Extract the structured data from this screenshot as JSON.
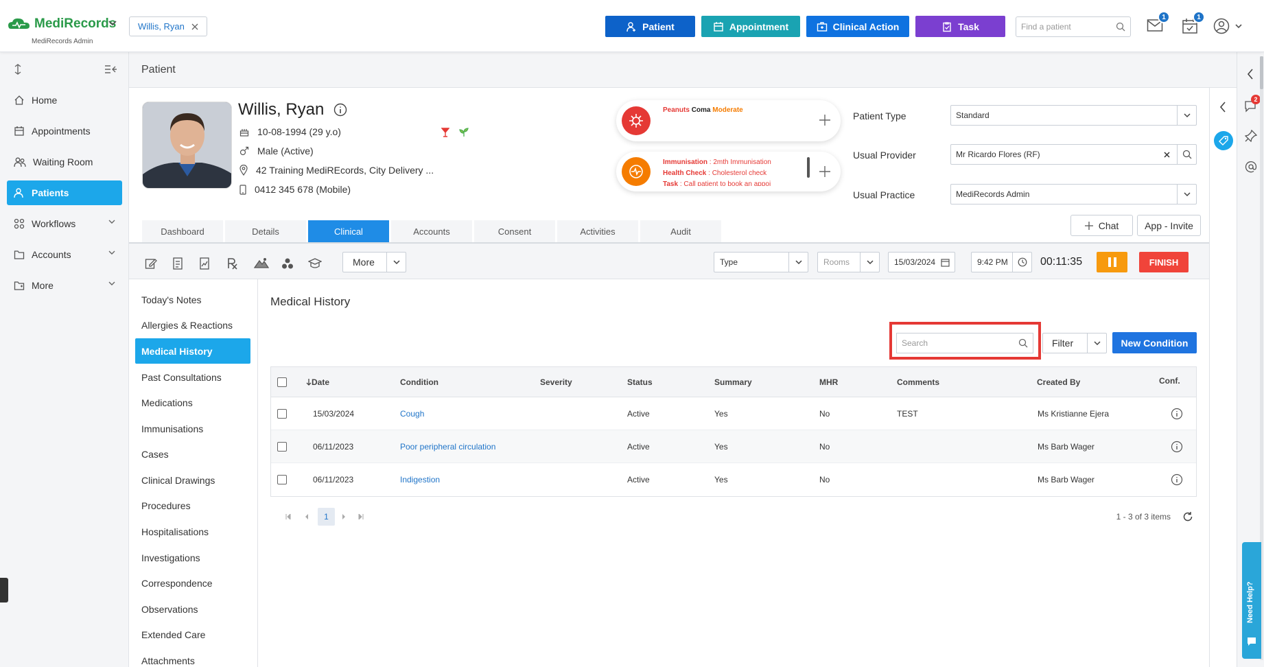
{
  "header": {
    "brand_name": "MediRecords",
    "brand_sub": "MediRecords Admin",
    "patient_chip": "Willis, Ryan",
    "buttons": [
      {
        "label": "Patient",
        "color": "#0d62c9"
      },
      {
        "label": "Appointment",
        "color": "#1aa3b2"
      },
      {
        "label": "Clinical Action",
        "color": "#0f72e0"
      },
      {
        "label": "Task",
        "color": "#7b3fd0"
      }
    ],
    "find_placeholder": "Find a patient",
    "mail_badge": "1",
    "calendar_badge": "1"
  },
  "sidebar": {
    "items": [
      {
        "label": "Home",
        "icon": "home-icon"
      },
      {
        "label": "Appointments",
        "icon": "calendar-icon"
      },
      {
        "label": "Waiting Room",
        "icon": "people-icon"
      },
      {
        "label": "Patients",
        "icon": "patients-icon",
        "active": true
      },
      {
        "label": "Workflows",
        "icon": "workflow-icon",
        "expandable": true
      },
      {
        "label": "Accounts",
        "icon": "folder-icon",
        "expandable": true
      },
      {
        "label": "More",
        "icon": "more-folder-icon",
        "expandable": true
      }
    ]
  },
  "page": {
    "title": "Patient"
  },
  "patient": {
    "name": "Willis, Ryan",
    "dob": "10-08-1994 (29 y.o)",
    "gender": "Male (Active)",
    "address": "42 Training MediREcords, City Delivery ...",
    "phone": "0412 345 678 (Mobile)"
  },
  "alerts": {
    "allergy": {
      "substance": "Peanuts",
      "reaction": "Coma",
      "severity": "Moderate"
    },
    "reminders": [
      {
        "type": "Immunisation",
        "text": "2mth Immunisation"
      },
      {
        "type": "Health Check",
        "text": "Cholesterol check"
      },
      {
        "type": "Task",
        "text": "Call patient to book an appoi"
      }
    ]
  },
  "patient_fields": {
    "type_label": "Patient Type",
    "type_value": "Standard",
    "provider_label": "Usual Provider",
    "provider_value": "Mr Ricardo Flores (RF)",
    "practice_label": "Usual Practice",
    "practice_value": "MediRecords Admin"
  },
  "actions": {
    "chat": "Chat",
    "invite": "App - Invite"
  },
  "tabs": [
    "Dashboard",
    "Details",
    "Clinical",
    "Accounts",
    "Consent",
    "Activities",
    "Audit"
  ],
  "active_tab": "Clinical",
  "toolbar": {
    "more": "More",
    "type_placeholder": "Type",
    "rooms_placeholder": "Rooms",
    "date": "15/03/2024",
    "time": "9:42 PM",
    "timer": "00:11:35",
    "finish": "FINISH"
  },
  "submenu": [
    "Today's Notes",
    "Allergies & Reactions",
    "Medical History",
    "Past Consultations",
    "Medications",
    "Immunisations",
    "Cases",
    "Clinical Drawings",
    "Procedures",
    "Hospitalisations",
    "Investigations",
    "Correspondence",
    "Observations",
    "Extended Care",
    "Attachments"
  ],
  "submenu_active": "Medical History",
  "medical_history": {
    "title": "Medical History",
    "search_placeholder": "Search",
    "filter": "Filter",
    "new_condition": "New Condition",
    "columns": [
      "Date",
      "Condition",
      "Severity",
      "Status",
      "Summary",
      "MHR",
      "Comments",
      "Created By",
      "Conf."
    ],
    "rows": [
      {
        "date": "15/03/2024",
        "condition": "Cough",
        "severity": "",
        "status": "Active",
        "summary": "Yes",
        "mhr": "No",
        "comments": "TEST",
        "created_by": "Ms Kristianne Ejera"
      },
      {
        "date": "06/11/2023",
        "condition": "Poor peripheral circulation",
        "severity": "",
        "status": "Active",
        "summary": "Yes",
        "mhr": "No",
        "comments": "",
        "created_by": "Ms Barb Wager"
      },
      {
        "date": "06/11/2023",
        "condition": "Indigestion",
        "severity": "",
        "status": "Active",
        "summary": "Yes",
        "mhr": "No",
        "comments": "",
        "created_by": "Ms Barb Wager"
      }
    ],
    "page": "1",
    "items_info": "1 - 3 of 3 items"
  },
  "right_panel": {
    "notification_badge": "2",
    "need_help": "Need Help?"
  }
}
